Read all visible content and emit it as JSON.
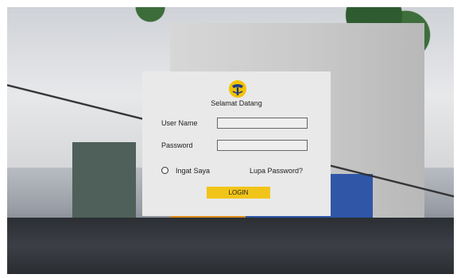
{
  "logo": {
    "icon": "pupr-logo-icon",
    "colors": {
      "yellow": "#f2c200",
      "blue": "#1b3a8c"
    }
  },
  "login": {
    "welcome": "Selamat Datang",
    "username_label": "User Name",
    "username_value": "",
    "password_label": "Password",
    "password_value": "",
    "remember_label": "Ingat Saya",
    "forgot_label": "Lupa Password?",
    "login_button": "LOGIN",
    "accent_color": "#f1c419"
  }
}
